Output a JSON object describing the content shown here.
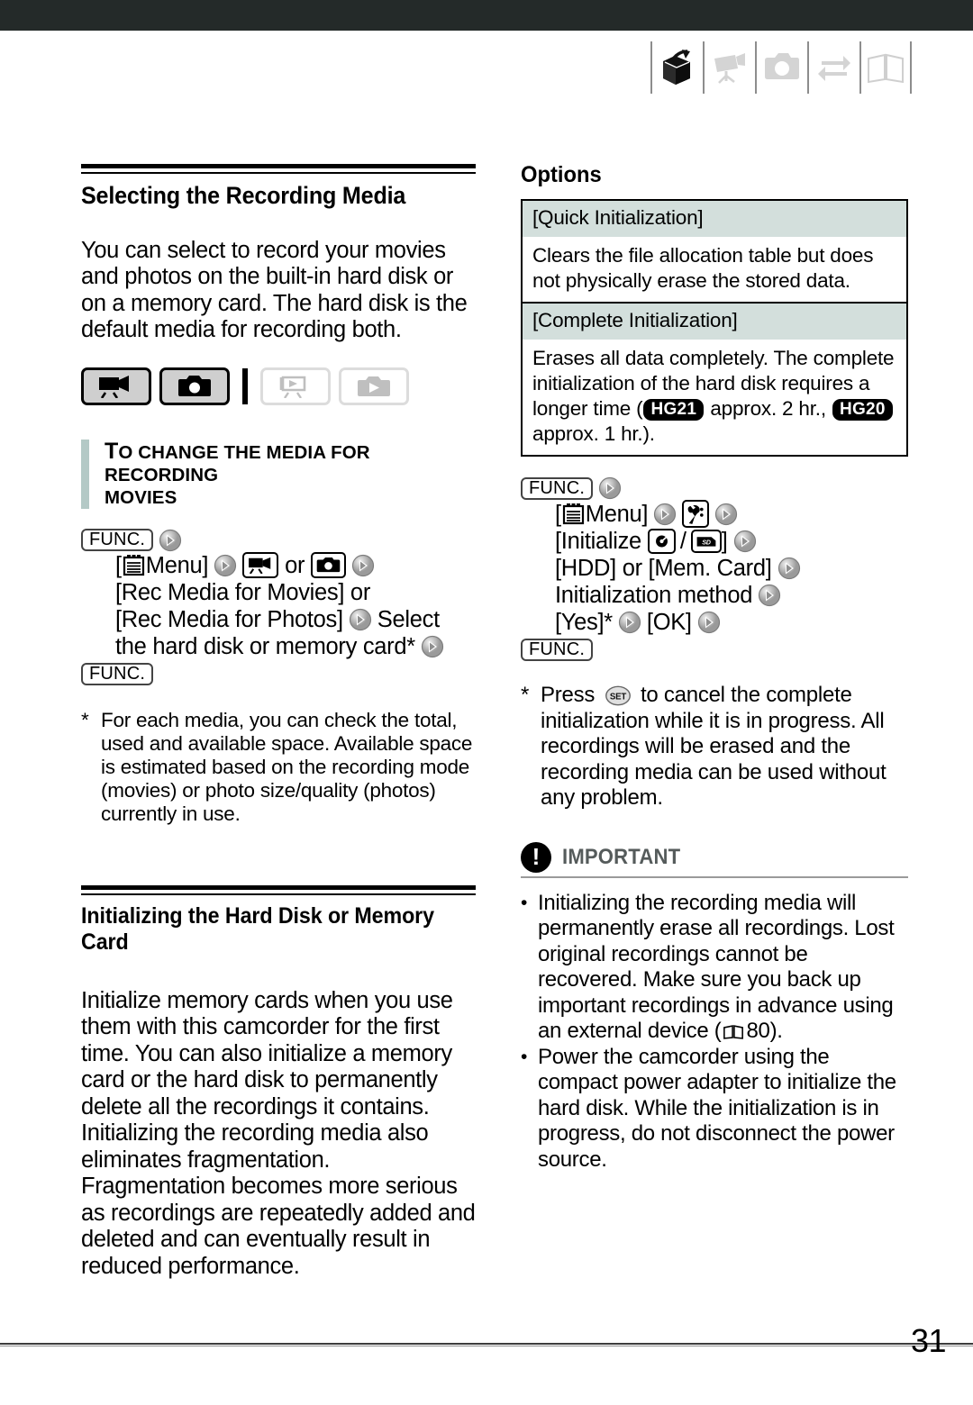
{
  "header": {
    "icons": [
      {
        "name": "box-arrow-icon",
        "state": "active"
      },
      {
        "name": "video-camera-icon",
        "state": "inactive"
      },
      {
        "name": "photo-camera-icon",
        "state": "inactive"
      },
      {
        "name": "exchange-arrows-icon",
        "state": "inactive"
      },
      {
        "name": "open-book-icon",
        "state": "inactive"
      }
    ]
  },
  "left": {
    "section_title": "Selecting the Recording Media",
    "intro": "You can select to record your movies and photos on the built-in hard disk or on a memory card. The hard disk is the default media for recording both.",
    "mode_buttons": [
      {
        "name": "mode-record-movies",
        "icon": "video-camera-icon",
        "state": "on"
      },
      {
        "name": "mode-record-photos",
        "icon": "photo-camera-icon",
        "state": "on"
      },
      {
        "name": "mode-play-movies",
        "icon": "playback-movies-icon",
        "state": "off"
      },
      {
        "name": "mode-play-photos",
        "icon": "playback-photos-icon",
        "state": "off"
      }
    ],
    "callout_title_1": "T",
    "callout_title_rest": "O CHANGE THE MEDIA FOR RECORDING",
    "callout_title_line2": "MOVIES",
    "proc": {
      "func_start": "FUNC.",
      "menu": "[",
      "menu_label": " Menu]",
      "or": "or",
      "line_rec_media_1": "[Rec Media for Movies] or",
      "line_rec_media_2": "[Rec Media for Photos]",
      "select_word": "Select",
      "line_select": "the hard disk or memory card*",
      "func_end": "FUNC."
    },
    "footnote_mark": "*",
    "footnote": "For each media, you can check the total, used and available space. Available space is estimated based on the recording mode (movies) or photo size/quality (photos) currently in use.",
    "section_title_2_line1": "Initializing the Hard Disk or Memory",
    "section_title_2_line2": "Card",
    "intro2": "Initialize memory cards when you use them with this camcorder for the first time. You can also initialize a memory card or the hard disk to permanently delete all the recordings it contains. Initializing the recording media also eliminates fragmentation.",
    "intro3": "Fragmentation becomes more serious as recordings are repeatedly added and deleted and can eventually result in reduced performance."
  },
  "right": {
    "options_title": "Options",
    "options_rows": [
      {
        "header": "[Quick Initialization]",
        "body": "Clears the file allocation table but does not physically erase the stored data."
      },
      {
        "header": "[Complete Initialization]",
        "body_part1": "Erases all data completely. The complete initialization of the hard disk requires a longer time (",
        "badge1": "HG21",
        "body_part2": " approx. 2 hr., ",
        "badge2": "HG20",
        "body_part3": " approx. 1 hr.)."
      }
    ],
    "proc": {
      "func_start": "FUNC.",
      "menu_open": "[",
      "menu_label": " Menu]",
      "initialize_open": "[Initialize",
      "slash": "/",
      "initialize_close": "]",
      "line_hdd": "[HDD] or [Mem. Card]",
      "line_method": "Initialization method",
      "line_yes": "[Yes]*",
      "line_ok": "[OK]",
      "func_end": "FUNC."
    },
    "footnote_mark": "*",
    "footnote_part1": "Press",
    "set_key": "SET",
    "footnote_part2": "to cancel the complete initialization while it is in progress. All recordings will be erased and the recording media can be used without any problem.",
    "important_label": "IMPORTANT",
    "important_items": [
      {
        "part1": "Initializing the recording media will permanently erase all recordings. Lost original recordings cannot be recovered. Make sure you back up important recordings in advance using an external device (",
        "page_ref": "80",
        "part2": ")."
      },
      {
        "text": "Power the camcorder using the compact power adapter to initialize the hard disk. While the initialization is in progress, do not disconnect the power source."
      }
    ]
  },
  "footer": {
    "page_number": "31"
  },
  "colors": {
    "top_bar": "#242a29",
    "teal_bar": "#b4c9c6",
    "table_header": "#d3dfdc",
    "important_label": "#555b5b"
  }
}
